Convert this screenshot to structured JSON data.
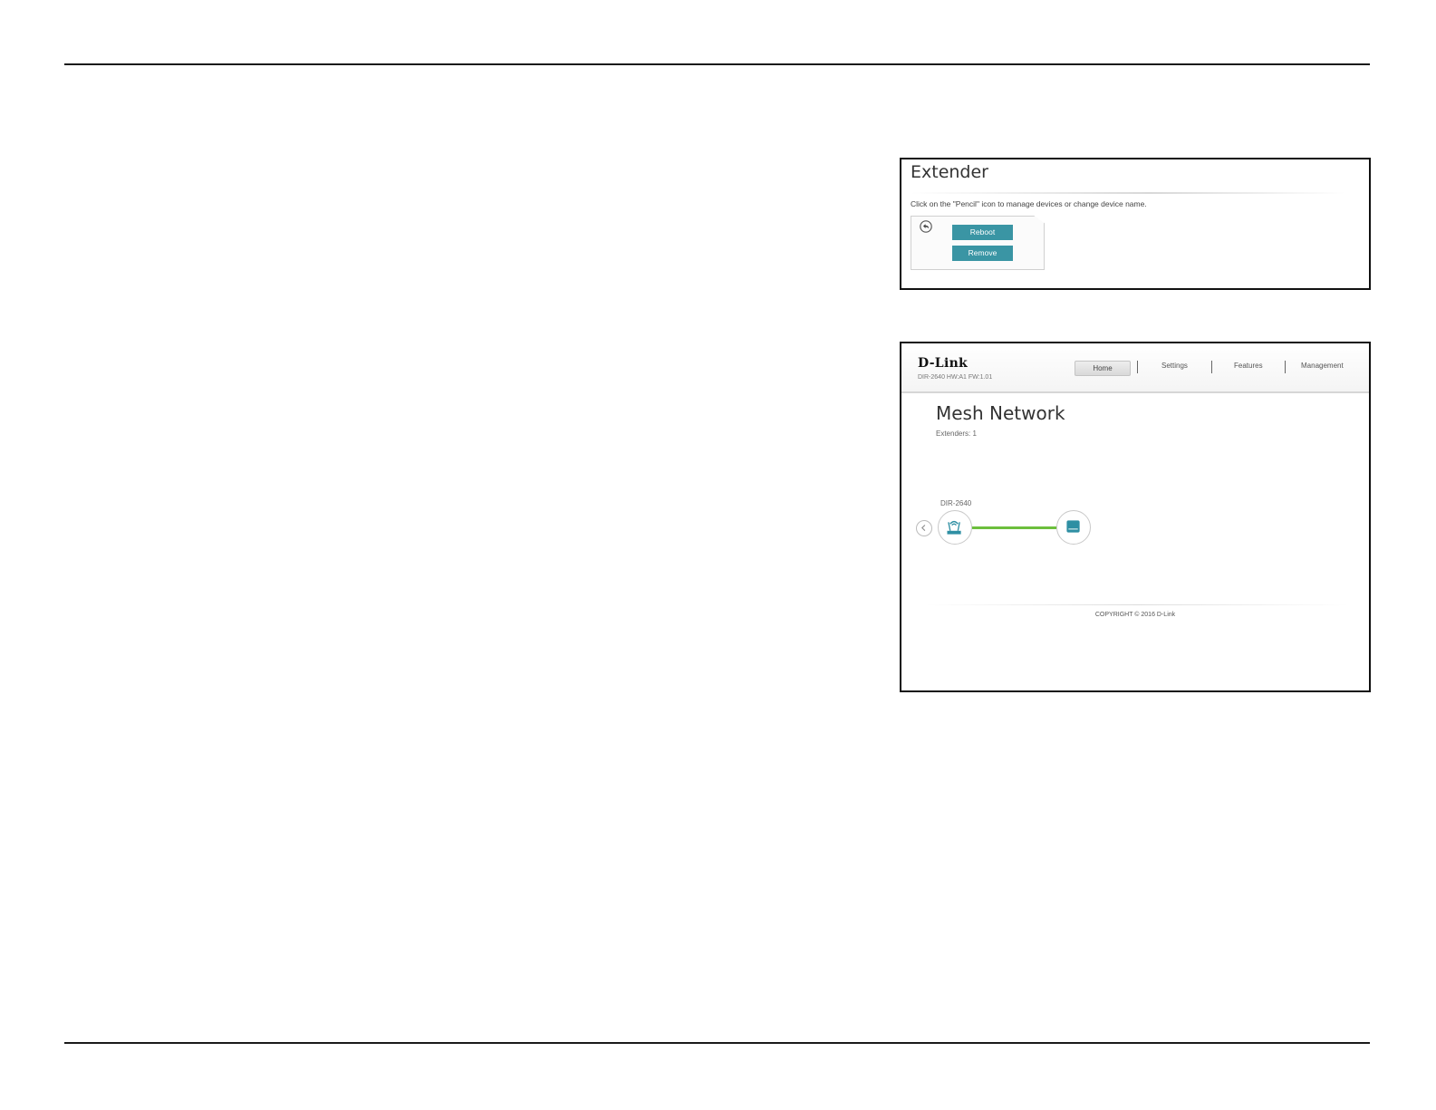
{
  "extender_panel": {
    "title": "Extender",
    "hint": "Click on the \"Pencil\" icon to manage devices or change device name.",
    "reboot_label": "Reboot",
    "remove_label": "Remove"
  },
  "mesh_panel": {
    "logo": "D-Link",
    "firmware": "DIR-2640 HW:A1 FW:1.01",
    "nav": {
      "home": "Home",
      "settings": "Settings",
      "features": "Features",
      "management": "Management"
    },
    "title": "Mesh Network",
    "extenders_count": "Extenders: 1",
    "device_label": "DIR-2640",
    "copyright": "COPYRIGHT © 2016 D-Link"
  },
  "colors": {
    "button_teal": "#3a95a4",
    "link_green": "#6cbf3d",
    "icon_teal": "#2e8fa3"
  },
  "icons": [
    "back-arrow-icon",
    "router-icon",
    "extender-icon",
    "chevron-left-icon"
  ]
}
